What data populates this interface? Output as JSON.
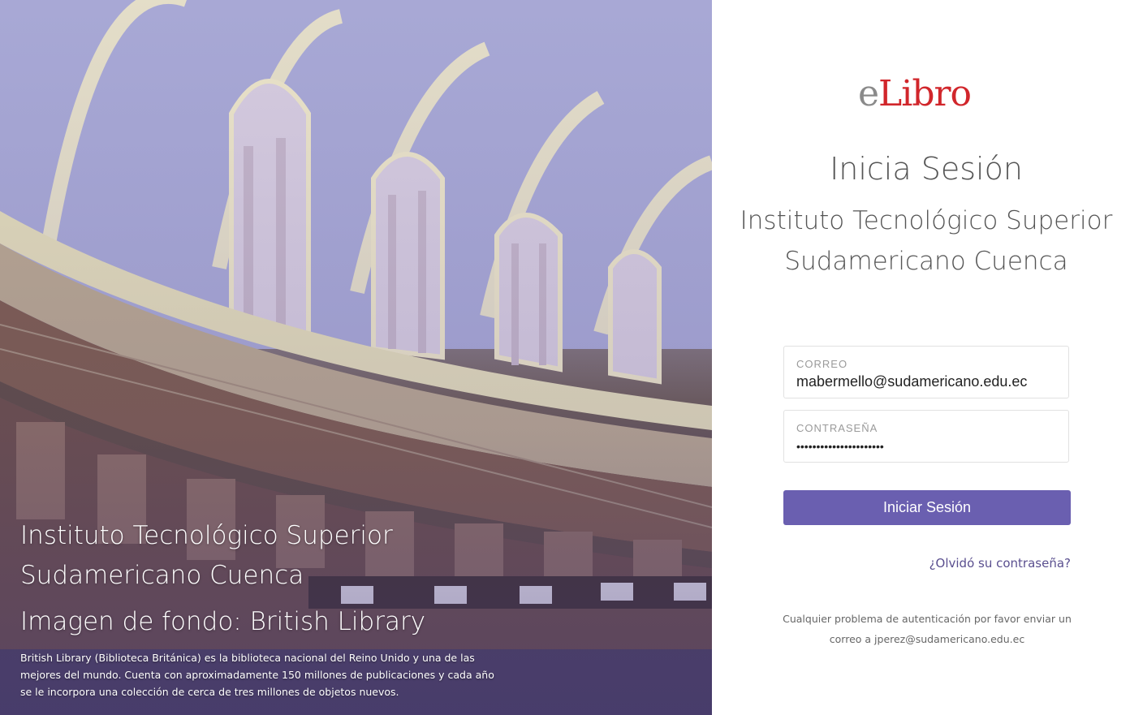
{
  "colors": {
    "accent": "#6a5fb0",
    "logo_e": "#8a8a8a",
    "logo_red": "#d1262b",
    "link": "#5a4f8f"
  },
  "hero": {
    "title": "Instituto Tecnológico Superior Sudamericano Cuenca",
    "subtitle": "Imagen de fondo: British Library",
    "description": "British Library (Biblioteca Británica) es la biblioteca nacional del Reino Unido y una de las mejores del mundo. Cuenta con aproximadamente 150 millones de publicaciones y cada año se le incorpora una colección de cerca de tres millones de objetos nuevos."
  },
  "logo": {
    "e": "e",
    "rest": "Libro"
  },
  "login": {
    "title": "Inicia Sesión",
    "institution": "Instituto Tecnológico Superior Sudamericano Cuenca",
    "email_label": "CORREO",
    "email_value": "mabermello@sudamericano.edu.ec",
    "password_label": "CONTRASEÑA",
    "password_value": "••••••••••••••••••••••",
    "submit_label": "Iniciar Sesión",
    "forgot_label": "¿Olvidó su contraseña?",
    "help_text": "Cualquier problema de autenticación por favor enviar un correo a jperez@sudamericano.edu.ec"
  }
}
